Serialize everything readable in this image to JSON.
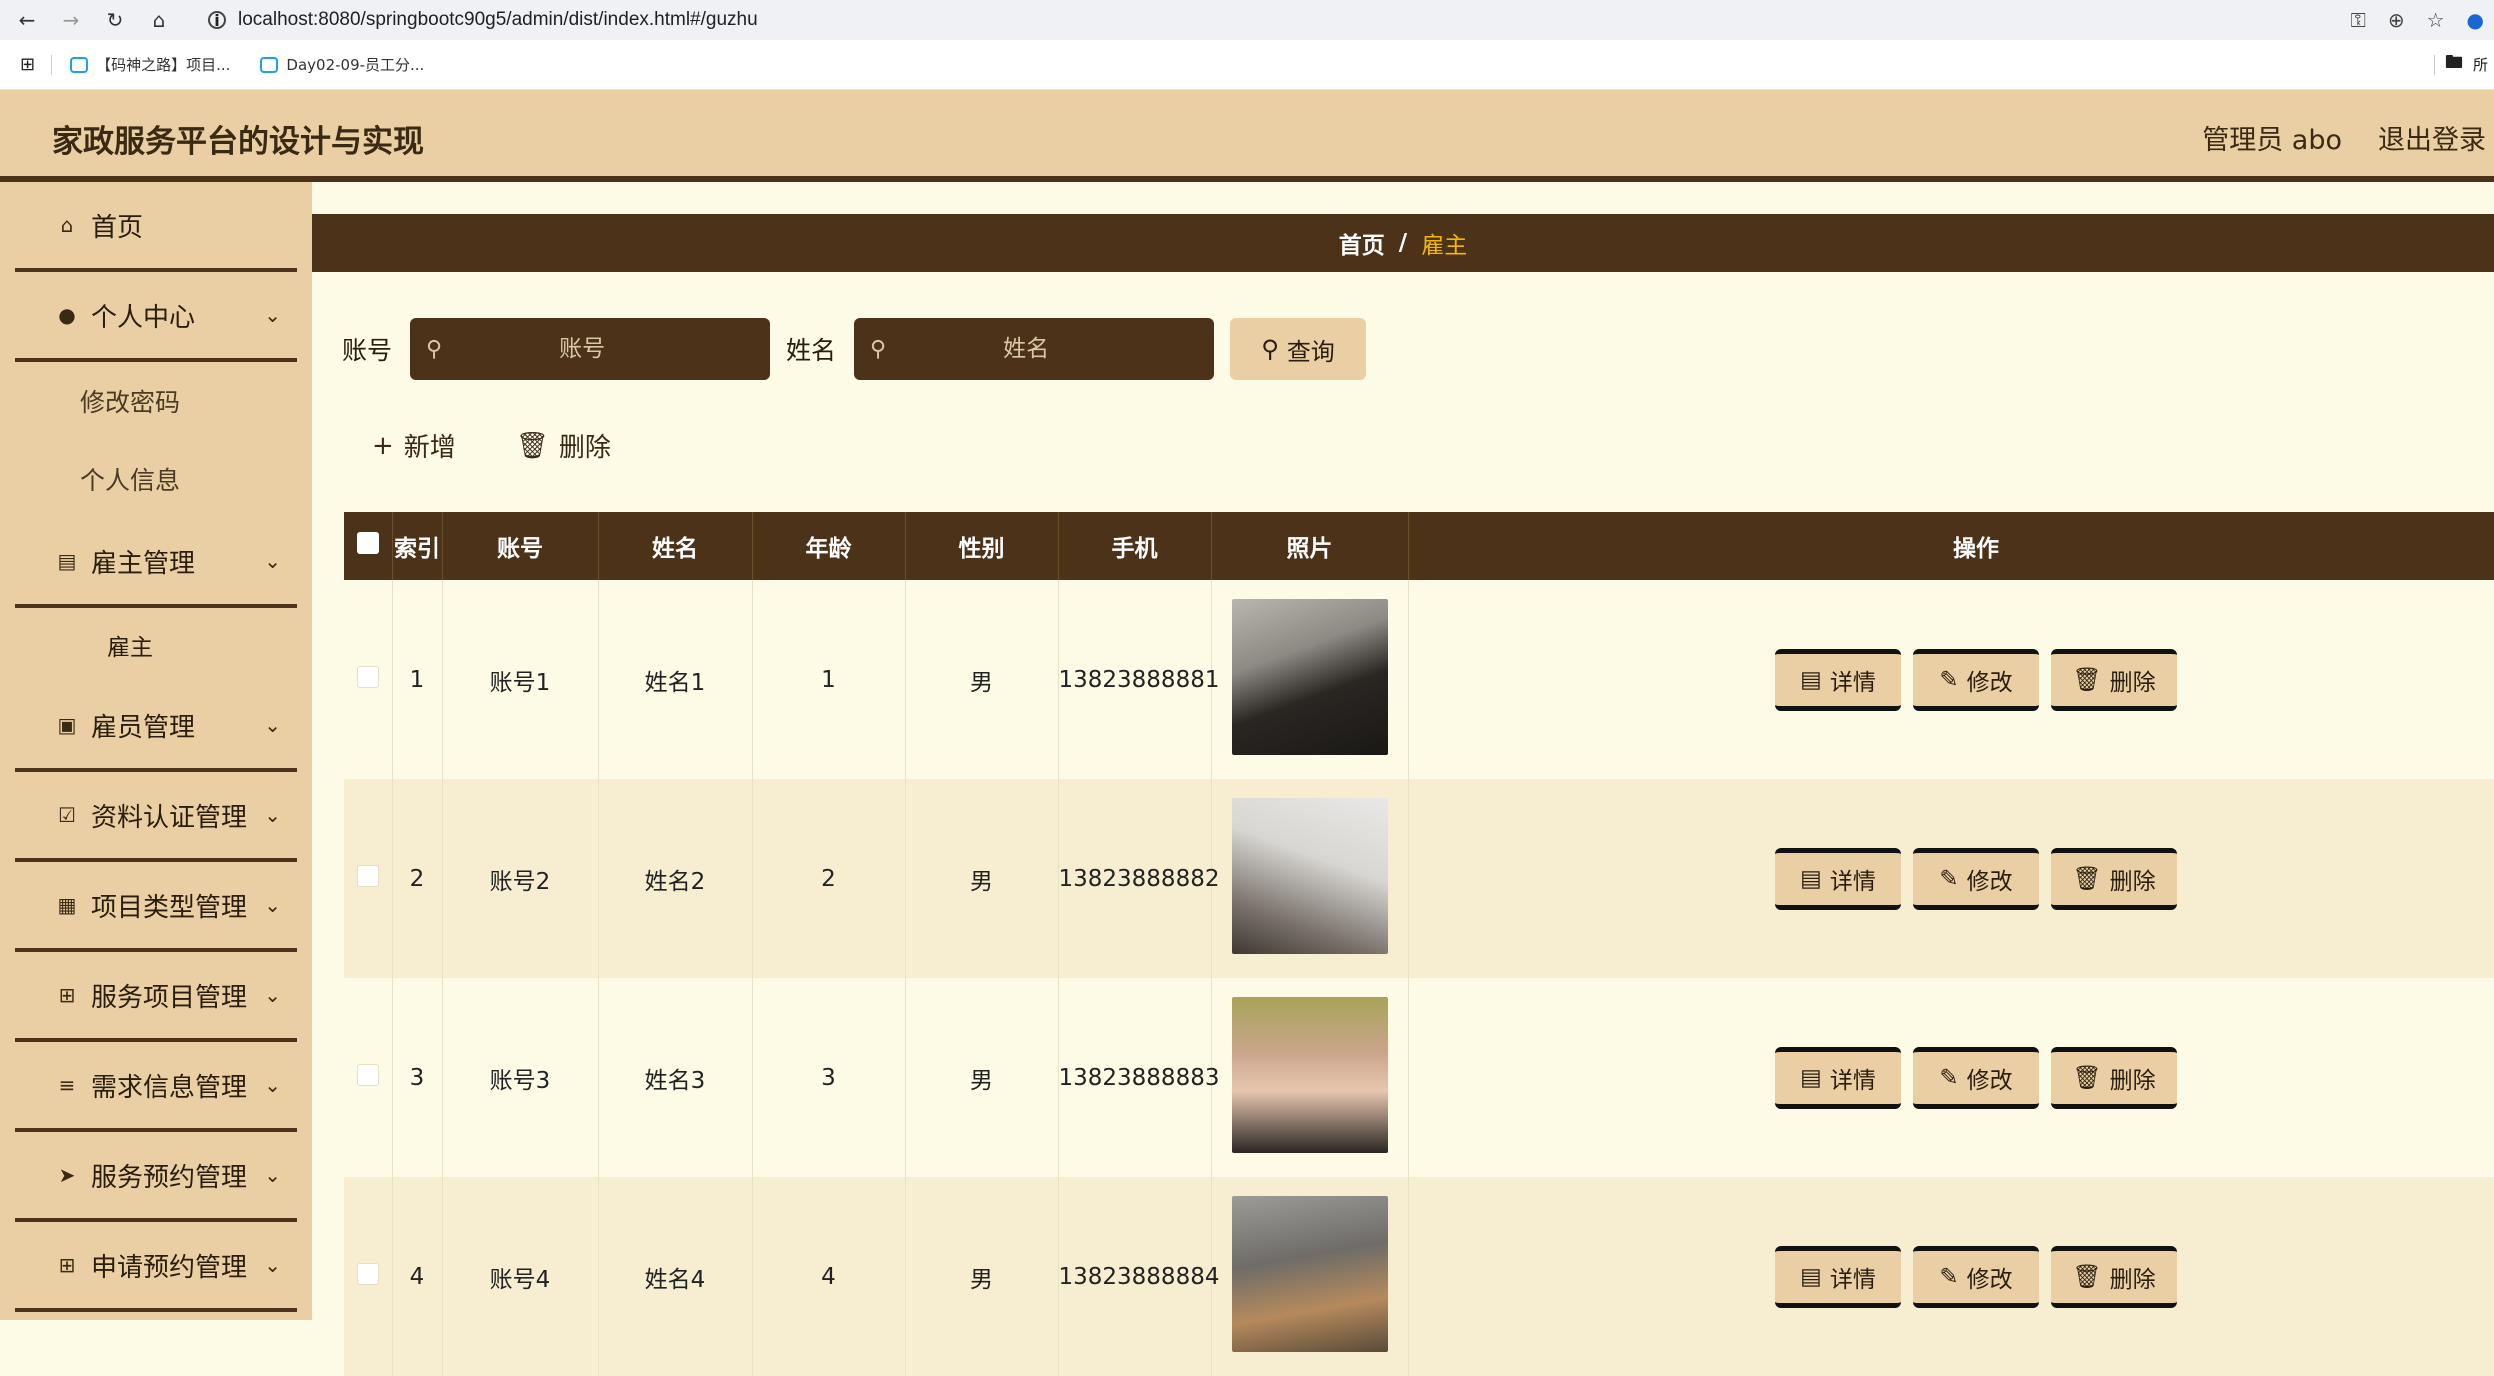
{
  "browser": {
    "url": "localhost:8080/springbootc90g5/admin/dist/index.html#/guzhu",
    "bookmarks": [
      "【码神之路】项目...",
      "Day02-09-员工分..."
    ],
    "bookmark_right": "所"
  },
  "header": {
    "title": "家政服务平台的设计与实现",
    "user": "管理员 abo",
    "logout": "退出登录"
  },
  "sidebar": {
    "items": [
      {
        "label": "首页",
        "icon": "home-icon",
        "has_chevron": false
      },
      {
        "label": "个人中心",
        "icon": "user-icon",
        "has_chevron": true,
        "sub": [
          "修改密码",
          "个人信息"
        ]
      },
      {
        "label": "雇主管理",
        "icon": "chart-icon",
        "has_chevron": true,
        "sub": [
          "雇主"
        ]
      },
      {
        "label": "雇员管理",
        "icon": "briefcase-icon",
        "has_chevron": true
      },
      {
        "label": "资料认证管理",
        "icon": "clipboard-icon",
        "has_chevron": true
      },
      {
        "label": "项目类型管理",
        "icon": "ticket-icon",
        "has_chevron": true
      },
      {
        "label": "服务项目管理",
        "icon": "grid-icon",
        "has_chevron": true
      },
      {
        "label": "需求信息管理",
        "icon": "list-icon",
        "has_chevron": true
      },
      {
        "label": "服务预约管理",
        "icon": "send-icon",
        "has_chevron": true
      },
      {
        "label": "申请预约管理",
        "icon": "grid-icon",
        "has_chevron": true
      }
    ]
  },
  "breadcrumb": {
    "home": "首页",
    "sep": "/",
    "current": "雇主"
  },
  "search": {
    "account_label": "账号",
    "account_placeholder": "账号",
    "name_label": "姓名",
    "name_placeholder": "姓名",
    "query_label": "查询"
  },
  "actions": {
    "add": "新增",
    "delete": "删除"
  },
  "table": {
    "columns": [
      "索引",
      "账号",
      "姓名",
      "年龄",
      "性别",
      "手机",
      "照片",
      "操作"
    ],
    "rows": [
      {
        "index": "1",
        "account": "账号1",
        "name": "姓名1",
        "age": "1",
        "gender": "男",
        "phone": "13823888881"
      },
      {
        "index": "2",
        "account": "账号2",
        "name": "姓名2",
        "age": "2",
        "gender": "男",
        "phone": "13823888882"
      },
      {
        "index": "3",
        "account": "账号3",
        "name": "姓名3",
        "age": "3",
        "gender": "男",
        "phone": "13823888883"
      },
      {
        "index": "4",
        "account": "账号4",
        "name": "姓名4",
        "age": "4",
        "gender": "男",
        "phone": "13823888884"
      }
    ],
    "op_labels": {
      "detail": "详情",
      "edit": "修改",
      "delete": "删除"
    }
  },
  "colors": {
    "header_bg": "#e9cfa3",
    "dark_brown": "#4b3219",
    "accent": "#f5b800",
    "content_bg": "#fdfbe6"
  }
}
